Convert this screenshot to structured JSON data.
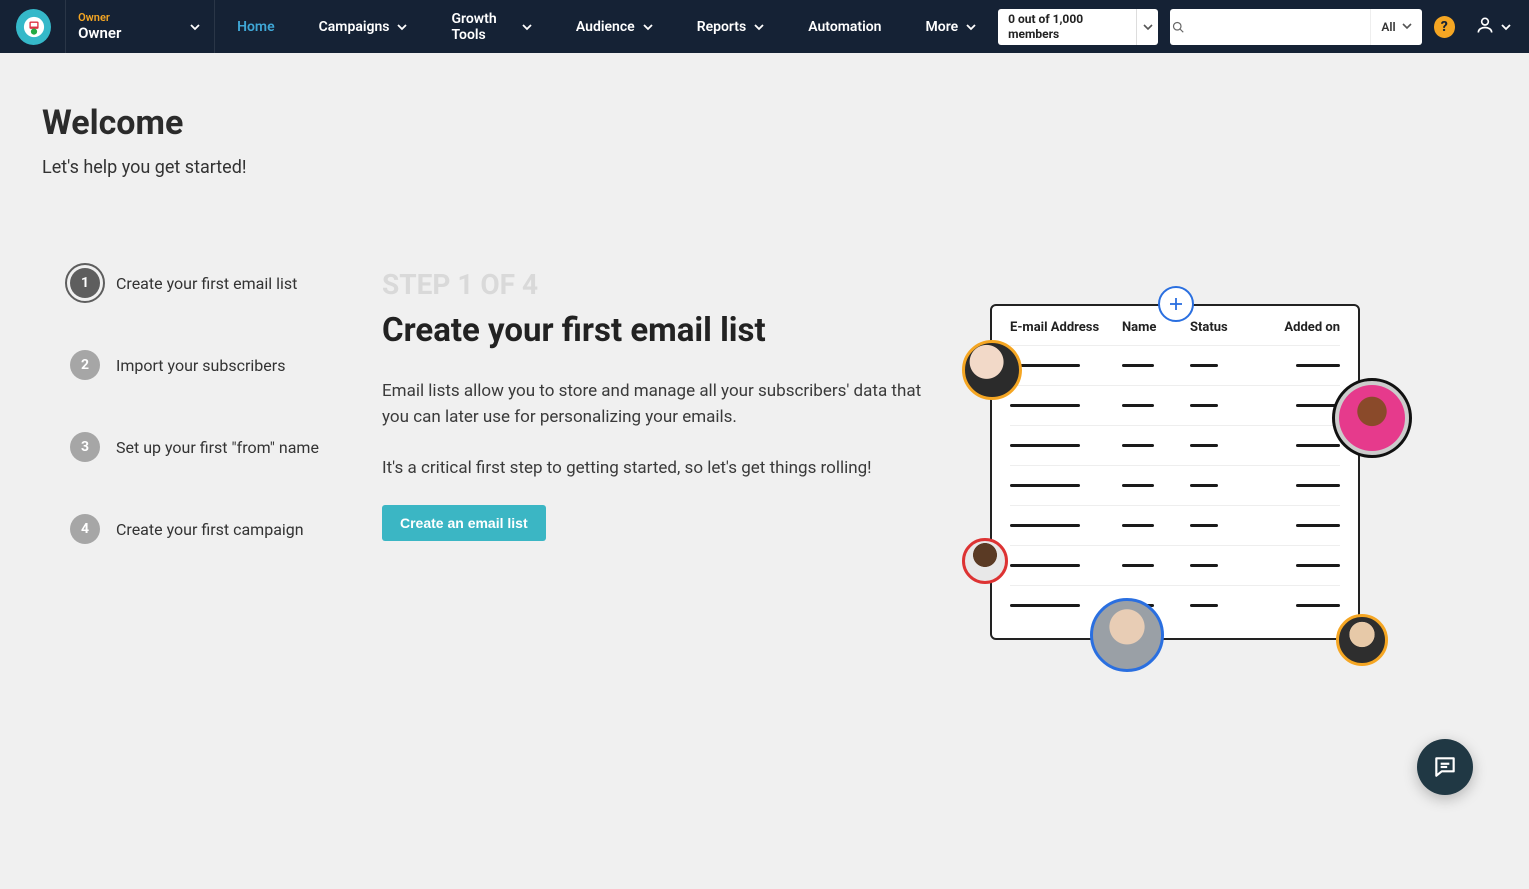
{
  "account": {
    "role": "Owner",
    "name": "Owner"
  },
  "nav": {
    "home": "Home",
    "campaigns": "Campaigns",
    "growth_tools": "Growth Tools",
    "audience": "Audience",
    "reports": "Reports",
    "automation": "Automation",
    "more": "More"
  },
  "members_box": "0 out of 1,000 members",
  "search": {
    "filter": "All",
    "placeholder": ""
  },
  "help_label": "?",
  "welcome": {
    "title": "Welcome",
    "subtitle": "Let's help you get started!"
  },
  "steps": [
    {
      "num": "1",
      "label": "Create your first email list"
    },
    {
      "num": "2",
      "label": "Import your subscribers"
    },
    {
      "num": "3",
      "label": "Set up your first \"from\" name"
    },
    {
      "num": "4",
      "label": "Create your first campaign"
    }
  ],
  "detail": {
    "step_count": "STEP 1 OF 4",
    "title": "Create your first email list",
    "p1": "Email lists allow you to store and manage all your subscribers' data that you can later use for personalizing your emails.",
    "p2": "It's a critical first step to getting started, so let's get things rolling!",
    "cta": "Create an email list"
  },
  "illus": {
    "col1": "E-mail Address",
    "col2": "Name",
    "col3": "Status",
    "col4": "Added on"
  }
}
